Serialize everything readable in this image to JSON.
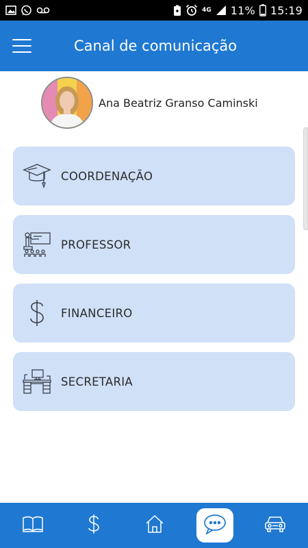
{
  "status_bar": {
    "network": "4G",
    "battery": "11%",
    "time": "15:19",
    "icons": [
      "image-icon",
      "whatsapp-icon",
      "voicemail-icon",
      "battery-saver-icon",
      "alarm-icon",
      "signal-icon",
      "battery-icon"
    ]
  },
  "header": {
    "title": "Canal de comunicação",
    "menu_icon": "hamburger-icon"
  },
  "profile": {
    "name": "Ana Beatriz Granso Caminski"
  },
  "menu": {
    "items": [
      {
        "label": "COORDENAÇÃO",
        "icon": "graduation-cap-icon"
      },
      {
        "label": "PROFESSOR",
        "icon": "teacher-board-icon"
      },
      {
        "label": "FINANCEIRO",
        "icon": "dollar-icon"
      },
      {
        "label": "SECRETARIA",
        "icon": "office-desk-icon"
      }
    ]
  },
  "bottom_nav": {
    "items": [
      {
        "icon": "book-icon",
        "active": false
      },
      {
        "icon": "dollar-icon",
        "active": false
      },
      {
        "icon": "home-icon",
        "active": false
      },
      {
        "icon": "chat-icon",
        "active": true
      },
      {
        "icon": "car-icon",
        "active": false
      }
    ]
  },
  "colors": {
    "primary": "#1f78d1",
    "card_background": "#cfe0f7",
    "status_bar": "#000000",
    "text": "#2b2b2b"
  }
}
